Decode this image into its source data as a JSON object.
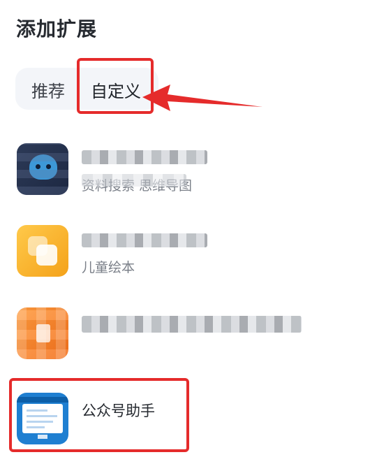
{
  "page": {
    "title": "添加扩展"
  },
  "tabs": [
    {
      "label": "推荐",
      "active": false
    },
    {
      "label": "自定义",
      "active": true
    }
  ],
  "extensions": [
    {
      "icon": "robot-icon",
      "name": "",
      "name_blurred": true,
      "description": "资料搜索 思维导图",
      "description_partially_blurred": true
    },
    {
      "icon": "overlapping-squares-icon",
      "name": "",
      "name_blurred": true,
      "description": "儿童绘本",
      "description_partially_blurred": false
    },
    {
      "icon": "orange-app-icon",
      "name": "",
      "name_blurred": true,
      "description": "",
      "description_partially_blurred": false
    },
    {
      "icon": "monitor-icon",
      "name": "公众号助手",
      "name_blurred": false,
      "description": "",
      "description_partially_blurred": false
    }
  ],
  "annotations": {
    "color": "#e52b2b",
    "highlighted": [
      "tab-custom",
      "extension-item-4"
    ]
  },
  "colors": {
    "tab_bg": "#f3f5f9",
    "text_primary": "#262a30",
    "text_secondary": "#7a7f88"
  }
}
